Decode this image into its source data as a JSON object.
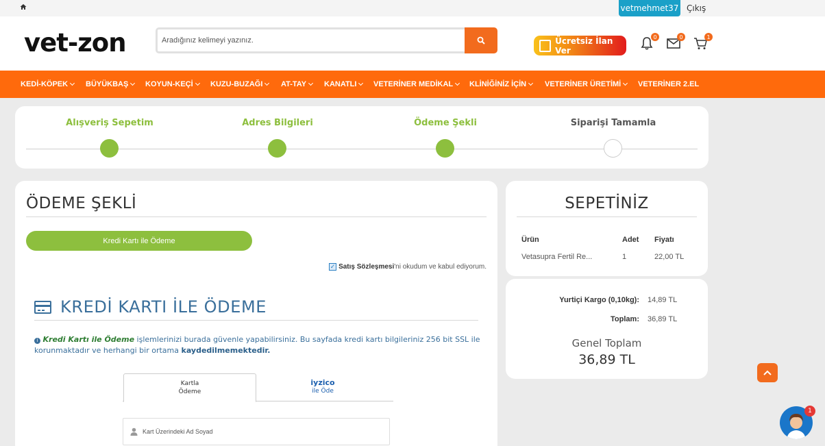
{
  "topbar": {
    "username": "vetmehmet37",
    "logout": "Çıkış"
  },
  "header": {
    "logo": "vet-zon",
    "search_placeholder": "Aradığınız kelimeyi yazınız.",
    "ilan_button": "Ücretsiz İlan Ver",
    "notif_count": "0",
    "msg_count": "0",
    "cart_count": "1"
  },
  "nav": {
    "items": [
      "KEDİ-KÖPEK",
      "BÜYÜKBAŞ",
      "KOYUN-KEÇİ",
      "KUZU-BUZAĞI",
      "AT-TAY",
      "KANATLI",
      "VETERİNER MEDİKAL",
      "KLİNİĞİNİZ İÇİN",
      "VETERİNER ÜRETİMİ",
      "VETERİNER 2.EL"
    ]
  },
  "steps": {
    "items": [
      "Alışveriş Sepetim",
      "Adres Bilgileri",
      "Ödeme Şekli",
      "Siparişi Tamamla"
    ]
  },
  "payment": {
    "title": "ÖDEME ŞEKLİ",
    "method_button": "Kredi Kartı ile Ödeme",
    "agree_bold": "Satış Sözleşmesi",
    "agree_rest": "'ni okudum ve kabul ediyorum.",
    "kk_title": "KREDİ KARTI İLE ÖDEME",
    "info_bold": "Kredi Kartı ile Ödeme",
    "info_text": " işlemlerinizi burada güvenle yapabilirsiniz. Bu sayfada kredi kartı bilgileriniz 256 bit SSL ile korunmaktadır ve herhangi bir ortama ",
    "info_strong": "kaydedilmemektedir.",
    "tab1_line1": "Kartla",
    "tab1_line2": "Ödeme",
    "tab2_line1": "iyzico",
    "tab2_line2": "ile Öde",
    "name_placeholder": "Kart Üzerindeki Ad Soyad"
  },
  "cart": {
    "title": "SEPETİNİZ",
    "col_product": "Ürün",
    "col_qty": "Adet",
    "col_price": "Fiyatı",
    "product": "Vetasupra Fertil Re...",
    "qty": "1",
    "price": "22,00 TL"
  },
  "summary": {
    "shipping_label": "Yurtiçi Kargo (0,10kg):",
    "shipping_value": "14,89 TL",
    "total_label": "Toplam:",
    "total_value": "36,89 TL",
    "grand_label": "Genel Toplam",
    "grand_value": "36,89 TL"
  },
  "chat": {
    "count": "1"
  },
  "colors": {
    "orange": "#ff6a0c",
    "green": "#8dbf3e",
    "blue": "#3a6f9b"
  }
}
